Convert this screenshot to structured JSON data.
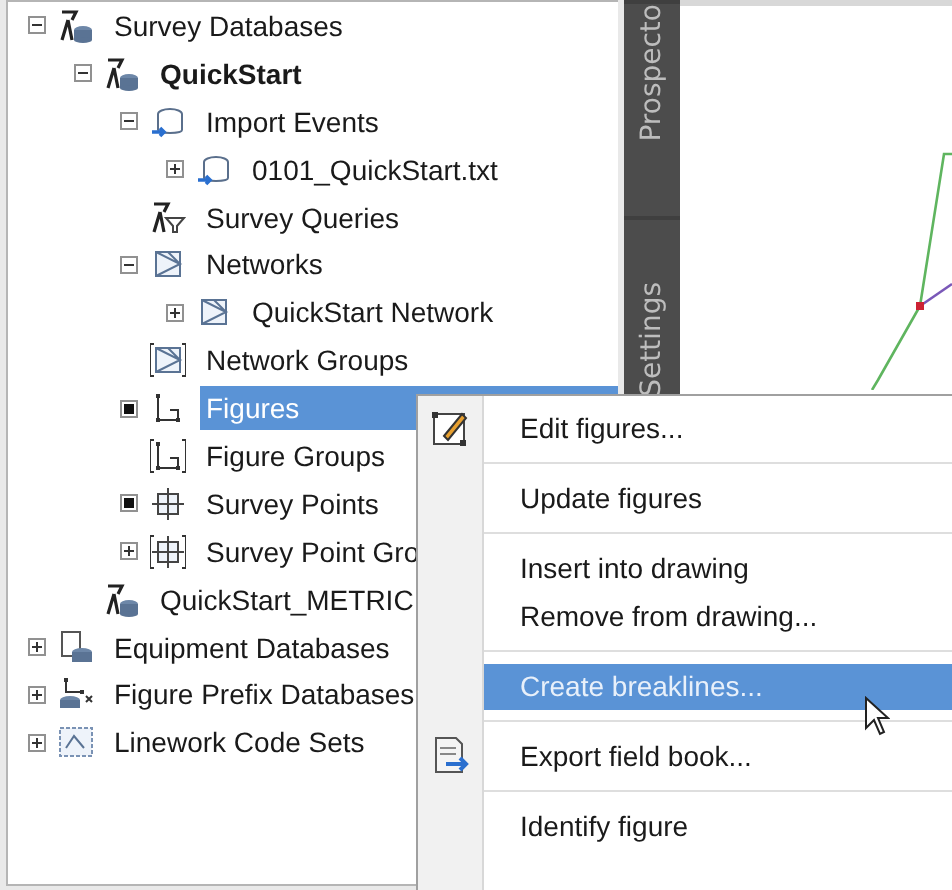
{
  "tree": [
    {
      "label": "Survey Databases",
      "kind": "database",
      "expanded": true,
      "selected": false,
      "current": false,
      "children": [
        {
          "label": "QuickStart",
          "kind": "database",
          "expanded": true,
          "selected": false,
          "current": true,
          "children": [
            {
              "label": "Import Events",
              "kind": "import",
              "expanded": true,
              "selected": false,
              "current": false,
              "children": [
                {
                  "label": "0101_QuickStart.txt",
                  "kind": "import",
                  "expanded": false,
                  "selected": false,
                  "current": false
                }
              ]
            },
            {
              "label": "Survey Queries",
              "kind": "query",
              "selected": false,
              "current": false
            },
            {
              "label": "Networks",
              "kind": "network",
              "expanded": true,
              "selected": false,
              "current": false,
              "children": [
                {
                  "label": "QuickStart Network",
                  "kind": "network",
                  "expanded": false,
                  "selected": false,
                  "current": false
                }
              ]
            },
            {
              "label": "Network Groups",
              "kind": "netgroup",
              "selected": false,
              "current": false
            },
            {
              "label": "Figures",
              "kind": "figure",
              "bullet": true,
              "selected": true,
              "current": false
            },
            {
              "label": "Figure Groups",
              "kind": "figgroup",
              "selected": false,
              "current": false
            },
            {
              "label": "Survey Points",
              "kind": "points",
              "bullet": true,
              "selected": false,
              "current": false
            },
            {
              "label": "Survey Point Gro",
              "kind": "pointgroup",
              "expanded": false,
              "selected": false,
              "current": false
            }
          ]
        },
        {
          "label": "QuickStart_METRIC",
          "kind": "database",
          "selected": false,
          "current": false
        }
      ]
    },
    {
      "label": "Equipment Databases",
      "kind": "equipment",
      "expanded": false,
      "selected": false,
      "current": false
    },
    {
      "label": "Figure Prefix Databases",
      "kind": "prefix",
      "expanded": false,
      "selected": false,
      "current": false
    },
    {
      "label": "Linework Code Sets",
      "kind": "linework",
      "expanded": false,
      "selected": false,
      "current": false
    }
  ],
  "side_tabs": [
    {
      "label": "Prospecto",
      "selected": false
    },
    {
      "label": "Settings",
      "selected": false
    }
  ],
  "context_menu": {
    "groups": [
      [
        {
          "label": "Edit figures...",
          "kind": "edit",
          "selected": false
        }
      ],
      [
        {
          "label": "Update figures",
          "kind": "plain",
          "selected": false
        }
      ],
      [
        {
          "label": "Insert into drawing",
          "kind": "plain",
          "selected": false
        },
        {
          "label": "Remove from drawing...",
          "kind": "plain",
          "selected": false
        }
      ],
      [
        {
          "label": "Create breaklines...",
          "kind": "plain",
          "selected": true
        }
      ],
      [
        {
          "label": "Export field book...",
          "kind": "export",
          "selected": false
        }
      ],
      [
        {
          "label": "Identify figure",
          "kind": "plain",
          "selected": false
        }
      ]
    ]
  }
}
